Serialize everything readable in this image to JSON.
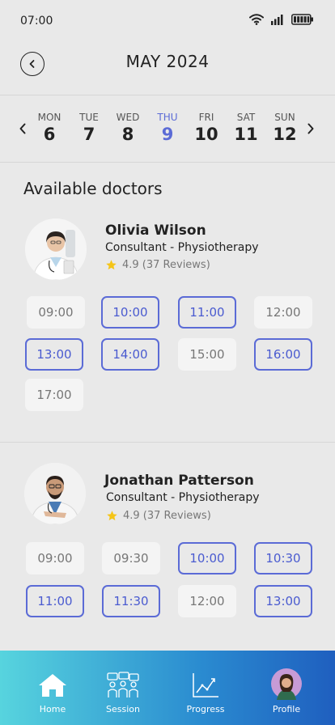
{
  "status": {
    "time": "07:00"
  },
  "header": {
    "title": "MAY 2024"
  },
  "dates": [
    {
      "day": "MON",
      "num": "6",
      "active": false
    },
    {
      "day": "TUE",
      "num": "7",
      "active": false
    },
    {
      "day": "WED",
      "num": "8",
      "active": false
    },
    {
      "day": "THU",
      "num": "9",
      "active": true
    },
    {
      "day": "FRI",
      "num": "10",
      "active": false
    },
    {
      "day": "SAT",
      "num": "11",
      "active": false
    },
    {
      "day": "SUN",
      "num": "12",
      "active": false
    }
  ],
  "section": {
    "title": "Available doctors"
  },
  "doctors": [
    {
      "name": "Olivia Wilson",
      "role": "Consultant - Physiotherapy",
      "rating": "4.9 (37 Reviews)",
      "slots": [
        {
          "time": "09:00",
          "available": false
        },
        {
          "time": "10:00",
          "available": true
        },
        {
          "time": "11:00",
          "available": true
        },
        {
          "time": "12:00",
          "available": false
        },
        {
          "time": "13:00",
          "available": true
        },
        {
          "time": "14:00",
          "available": true
        },
        {
          "time": "15:00",
          "available": false
        },
        {
          "time": "16:00",
          "available": true
        },
        {
          "time": "17:00",
          "available": false
        }
      ]
    },
    {
      "name": "Jonathan Patterson",
      "role": "Consultant - Physiotherapy",
      "rating": "4.9 (37 Reviews)",
      "slots": [
        {
          "time": "09:00",
          "available": false
        },
        {
          "time": "09:30",
          "available": false
        },
        {
          "time": "10:00",
          "available": true
        },
        {
          "time": "10:30",
          "available": true
        },
        {
          "time": "11:00",
          "available": true
        },
        {
          "time": "11:30",
          "available": true
        },
        {
          "time": "12:00",
          "available": false
        },
        {
          "time": "13:00",
          "available": true
        }
      ]
    }
  ],
  "nav": [
    {
      "label": "Home",
      "icon": "home-icon"
    },
    {
      "label": "Session",
      "icon": "session-icon"
    },
    {
      "label": "Progress",
      "icon": "progress-icon"
    },
    {
      "label": "Profile",
      "icon": "profile-avatar-icon"
    }
  ],
  "colors": {
    "accent": "#5b6bd6",
    "star": "#f5c518",
    "nav_start": "#57d4de",
    "nav_end": "#1f5fbf"
  }
}
